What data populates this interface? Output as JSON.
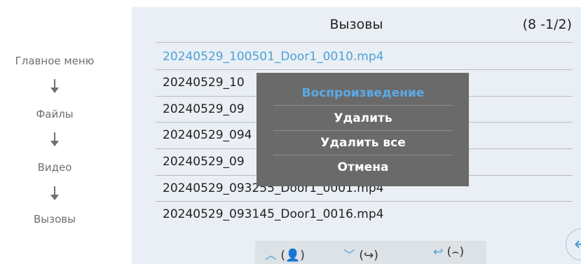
{
  "breadcrumb": {
    "items": [
      "Главное меню",
      "Файлы",
      "Видео",
      "Вызовы"
    ]
  },
  "header": {
    "title": "Вызовы",
    "count": "(8 -1/2)"
  },
  "files": [
    "20240529_100501_Door1_0010.mp4",
    "20240529_10",
    "20240529_09",
    "20240529_094",
    "20240529_09",
    "20240529_093255_Door1_0001.mp4",
    "20240529_093145_Door1_0016.mp4"
  ],
  "menu": {
    "items": [
      "Воспроизведение",
      "Удалить",
      "Удалить все",
      "Отмена"
    ]
  },
  "toolbar": {
    "up_label": "(👤)",
    "down_label": "(↪)",
    "back_label": "(⌢)"
  },
  "colors": {
    "accent": "#4fa1d8",
    "panel": "#e9eff4",
    "menu": "#6a6a6a"
  }
}
